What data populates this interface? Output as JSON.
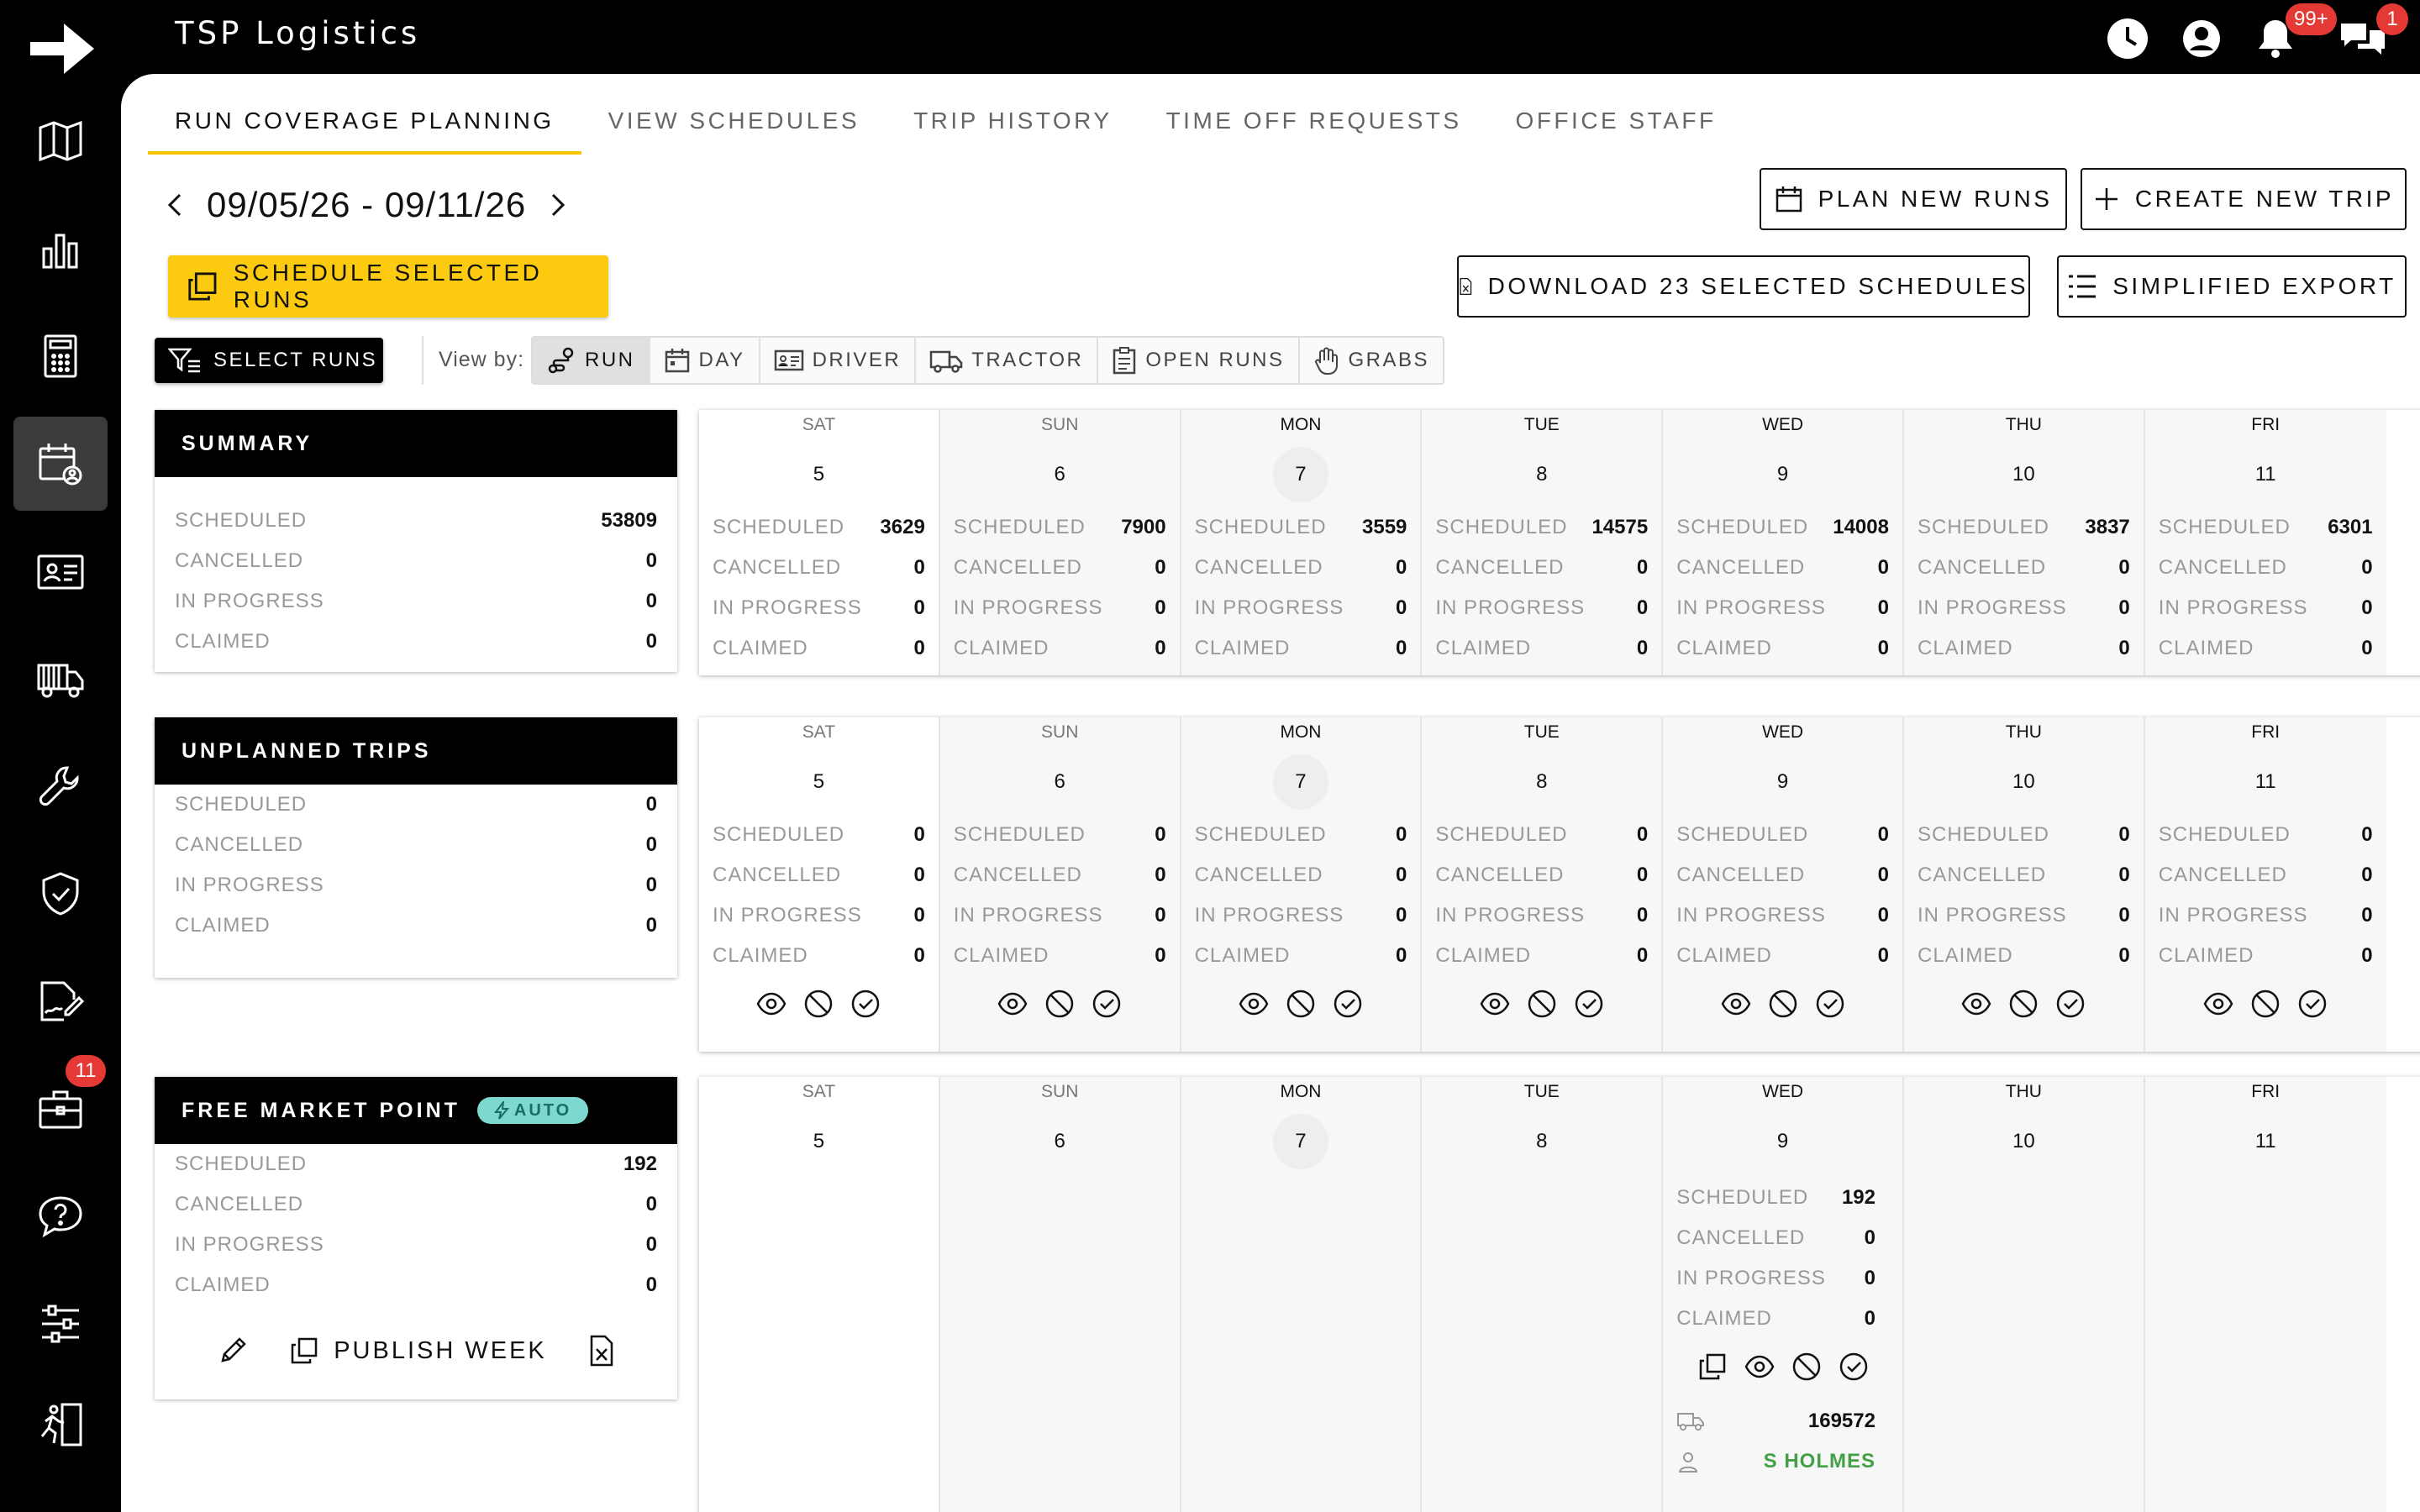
{
  "app": {
    "title": "TSP Logistics"
  },
  "sidebar": {
    "items": [
      {
        "icon": "map-icon"
      },
      {
        "icon": "bar-chart-icon"
      },
      {
        "icon": "calculator-icon"
      },
      {
        "icon": "calendar-user-icon",
        "active": true
      },
      {
        "icon": "id-card-icon"
      },
      {
        "icon": "truck-icon"
      },
      {
        "icon": "wrench-icon"
      },
      {
        "icon": "shield-check-icon"
      },
      {
        "icon": "signature-icon"
      },
      {
        "icon": "briefcase-icon",
        "badge": "11"
      },
      {
        "icon": "help-chat-icon"
      },
      {
        "icon": "sliders-icon"
      },
      {
        "icon": "running-person-icon"
      }
    ]
  },
  "topbar": {
    "notifications_badge": "99+",
    "messages_badge": "1"
  },
  "tabs": [
    {
      "label": "RUN COVERAGE PLANNING",
      "active": true
    },
    {
      "label": "VIEW SCHEDULES"
    },
    {
      "label": "TRIP HISTORY"
    },
    {
      "label": "TIME OFF REQUESTS"
    },
    {
      "label": "OFFICE STAFF"
    }
  ],
  "date_range": "09/05/26 - 09/11/26",
  "buttons": {
    "plan_new_runs": "PLAN NEW RUNS",
    "create_new_trip": "CREATE NEW TRIP",
    "schedule_selected_runs": "SCHEDULE SELECTED RUNS",
    "download_selected": "DOWNLOAD 23 SELECTED SCHEDULES",
    "simplified_export": "SIMPLIFIED EXPORT",
    "select_runs": "SELECT RUNS"
  },
  "view_by": {
    "label": "View by:",
    "options": [
      "RUN",
      "DAY",
      "DRIVER",
      "TRACTOR",
      "OPEN RUNS",
      "GRABS"
    ],
    "selected": "RUN"
  },
  "status_labels": {
    "scheduled": "SCHEDULED",
    "cancelled": "CANCELLED",
    "in_progress": "IN PROGRESS",
    "claimed": "CLAIMED"
  },
  "summary": {
    "title": "SUMMARY",
    "scheduled": "53809",
    "cancelled": "0",
    "in_progress": "0",
    "claimed": "0"
  },
  "days": [
    {
      "name": "SAT",
      "num": "5"
    },
    {
      "name": "SUN",
      "num": "6"
    },
    {
      "name": "MON",
      "num": "7",
      "today": true
    },
    {
      "name": "TUE",
      "num": "8"
    },
    {
      "name": "WED",
      "num": "9"
    },
    {
      "name": "THU",
      "num": "10"
    },
    {
      "name": "FRI",
      "num": "11"
    }
  ],
  "summary_week": [
    {
      "scheduled": "3629",
      "cancelled": "0",
      "in_progress": "0",
      "claimed": "0"
    },
    {
      "scheduled": "7900",
      "cancelled": "0",
      "in_progress": "0",
      "claimed": "0"
    },
    {
      "scheduled": "3559",
      "cancelled": "0",
      "in_progress": "0",
      "claimed": "0"
    },
    {
      "scheduled": "14575",
      "cancelled": "0",
      "in_progress": "0",
      "claimed": "0"
    },
    {
      "scheduled": "14008",
      "cancelled": "0",
      "in_progress": "0",
      "claimed": "0"
    },
    {
      "scheduled": "3837",
      "cancelled": "0",
      "in_progress": "0",
      "claimed": "0"
    },
    {
      "scheduled": "6301",
      "cancelled": "0",
      "in_progress": "0",
      "claimed": "0"
    }
  ],
  "unplanned": {
    "title": "UNPLANNED TRIPS",
    "scheduled": "0",
    "cancelled": "0",
    "in_progress": "0",
    "claimed": "0"
  },
  "unplanned_week": [
    {
      "scheduled": "0",
      "cancelled": "0",
      "in_progress": "0",
      "claimed": "0"
    },
    {
      "scheduled": "0",
      "cancelled": "0",
      "in_progress": "0",
      "claimed": "0"
    },
    {
      "scheduled": "0",
      "cancelled": "0",
      "in_progress": "0",
      "claimed": "0"
    },
    {
      "scheduled": "0",
      "cancelled": "0",
      "in_progress": "0",
      "claimed": "0"
    },
    {
      "scheduled": "0",
      "cancelled": "0",
      "in_progress": "0",
      "claimed": "0"
    },
    {
      "scheduled": "0",
      "cancelled": "0",
      "in_progress": "0",
      "claimed": "0"
    },
    {
      "scheduled": "0",
      "cancelled": "0",
      "in_progress": "0",
      "claimed": "0"
    }
  ],
  "free_market": {
    "title": "FREE MARKET POINT",
    "badge": "AUTO",
    "scheduled": "192",
    "cancelled": "0",
    "in_progress": "0",
    "claimed": "0",
    "publish_label": "PUBLISH WEEK",
    "wed": {
      "scheduled": "192",
      "cancelled": "0",
      "in_progress": "0",
      "claimed": "0",
      "tractor": "169572",
      "driver": "S HOLMES"
    }
  },
  "colors": {
    "accent": "#fccb0f",
    "badge": "#e53935",
    "auto_badge": "#7dd9d0",
    "driver_green": "#43a047"
  }
}
